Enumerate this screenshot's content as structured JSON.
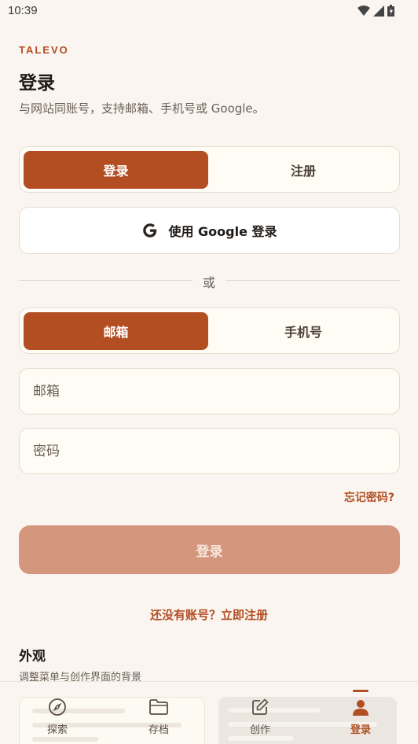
{
  "status_bar": {
    "time": "10:39"
  },
  "brand": "TALEVO",
  "header": {
    "title": "登录",
    "subtitle": "与网站同账号，支持邮箱、手机号或 Google。"
  },
  "auth_tabs": {
    "active": "登录",
    "inactive": "注册"
  },
  "google_button": {
    "label": "使用 Google 登录",
    "icon": "google-g-icon"
  },
  "divider": {
    "text": "或"
  },
  "method_tabs": {
    "active": "邮箱",
    "inactive": "手机号"
  },
  "form": {
    "email_placeholder": "邮箱",
    "password_placeholder": "密码"
  },
  "forgot_password": "忘记密码?",
  "submit_label": "登录",
  "signup_prompt": "还没有账号？立即注册",
  "appearance": {
    "title": "外观",
    "description": "调整菜单与创作界面的背景"
  },
  "bottom_nav": {
    "items": [
      {
        "label": "探索",
        "icon": "compass-icon"
      },
      {
        "label": "存档",
        "icon": "folder-icon"
      },
      {
        "label": "创作",
        "icon": "edit-icon"
      },
      {
        "label": "登录",
        "icon": "person-icon",
        "active": true
      }
    ]
  },
  "colors": {
    "accent": "#b24e22",
    "submit_disabled": "#d4967c",
    "background": "#faf5f0"
  }
}
